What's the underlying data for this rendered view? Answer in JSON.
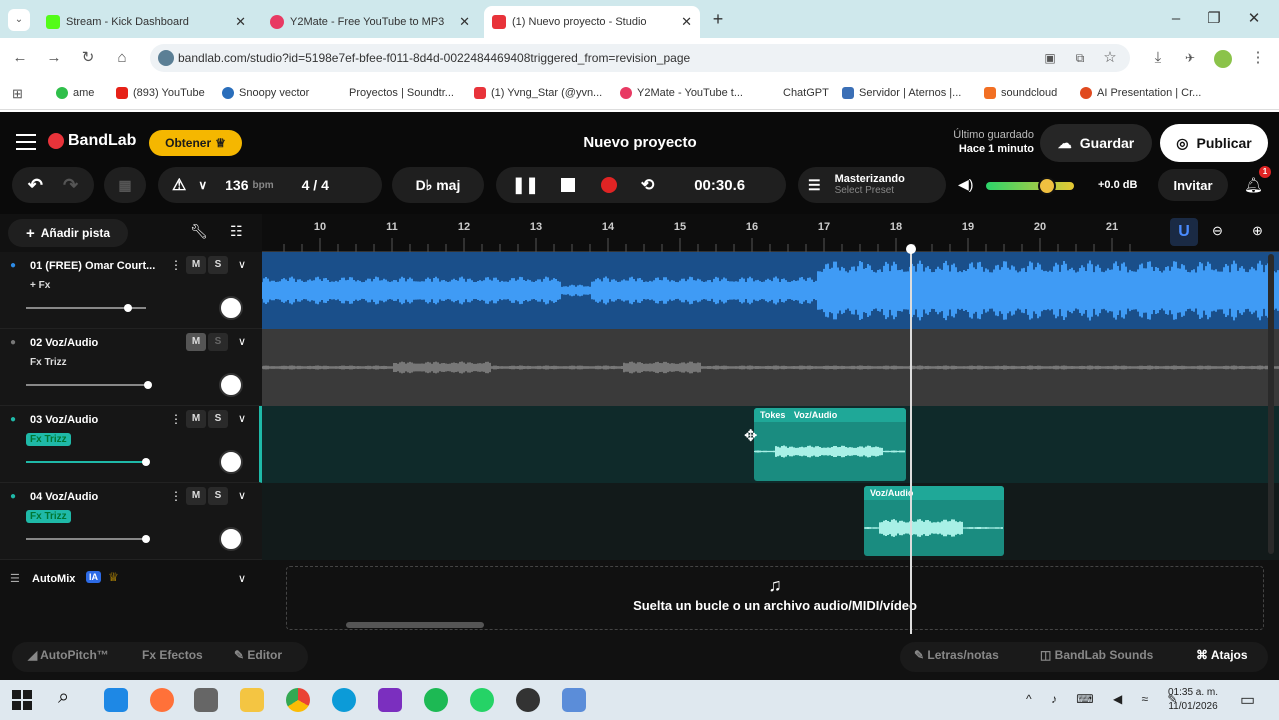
{
  "browser": {
    "tabs": [
      {
        "label": "Stream - Kick Dashboard",
        "color": "#53fc18"
      },
      {
        "label": "Y2Mate - Free YouTube to MP3",
        "color": "#e83a63"
      },
      {
        "label": "(1) Nuevo proyecto - Studio",
        "color": "#e8333a",
        "active": true
      }
    ],
    "new_tab": "+",
    "url": "bandlab.com/studio?id=5198e7ef-bfee-f011-8d4d-0022484469408triggered_from=revision_page",
    "bookmarks": [
      {
        "label": "ame",
        "color": "#2fbf4a"
      },
      {
        "label": "(893) YouTube",
        "color": "#e62117"
      },
      {
        "label": "Snoopy vector",
        "color": "#2a6ebb"
      },
      {
        "label": "Proyectos | Soundtr...",
        "color": "#ffffff"
      },
      {
        "label": "(1) Yvng_Star (@yvn...",
        "color": "#e8333a"
      },
      {
        "label": "Y2Mate - YouTube t...",
        "color": "#e83a63"
      },
      {
        "label": "ChatGPT",
        "color": "#ffffff"
      },
      {
        "label": "Servidor | Aternos |...",
        "color": "#3b6fb6"
      },
      {
        "label": "soundcloud",
        "color": "#f26f23"
      },
      {
        "label": "AI Presentation | Cr...",
        "color": "#e04a1f"
      }
    ]
  },
  "app": {
    "logo": "BandLab",
    "get_button": "Obtener",
    "project_title": "Nuevo proyecto",
    "last_saved_label": "Último guardado",
    "last_saved_time": "Hace 1 minuto",
    "save_button": "Guardar",
    "publish_button": "Publicar"
  },
  "toolbar": {
    "bpm": "136",
    "bpm_unit": "bpm",
    "time_signature": "4 / 4",
    "key": "D♭ maj",
    "time": "00:30.6",
    "mastering_title": "Masterizando",
    "mastering_sub": "Select Preset",
    "volume_db": "+0.0 dB",
    "invite_button": "Invitar",
    "notification_count": "1",
    "add_track": "Añadir pista"
  },
  "ruler": [
    "10",
    "11",
    "12",
    "13",
    "14",
    "15",
    "16",
    "17",
    "18",
    "19",
    "20",
    "21"
  ],
  "tracks": [
    {
      "name": "01 (FREE) Omar Court...",
      "fx": "+ Fx",
      "fx_style": "plain",
      "volume": 0.85,
      "color": "#2d8be6"
    },
    {
      "name": "02 Voz/Audio",
      "fx": "Fx Trizz",
      "fx_style": "plain",
      "volume": 1.0,
      "color": "#444444"
    },
    {
      "name": "03 Voz/Audio",
      "fx": "Fx Trizz",
      "fx_style": "teal",
      "volume": 1.0,
      "color": "#1fb9a8"
    },
    {
      "name": "04 Voz/Audio",
      "fx": "Fx Trizz",
      "fx_style": "teal",
      "volume": 1.0,
      "color": "#1fb9a8"
    }
  ],
  "mute_label": "M",
  "solo_label": "S",
  "clips": {
    "clip1_tag": "Tokes",
    "clip1_label": "Voz/Audio",
    "clip2_label": "Voz/Audio"
  },
  "automix": {
    "label": "AutoMix",
    "badge": "IA"
  },
  "drop_zone": "Suelta un bucle o un archivo audio/MIDI/vídeo",
  "bottom": {
    "autopitch": "AutoPitch™",
    "effects": "Efectos",
    "editor": "Editor",
    "lyrics": "Letras/notas",
    "sounds": "BandLab Sounds",
    "shortcuts": "Atajos"
  },
  "taskbar": {
    "time": "01:35 a. m.",
    "date": "11/01/2026"
  }
}
